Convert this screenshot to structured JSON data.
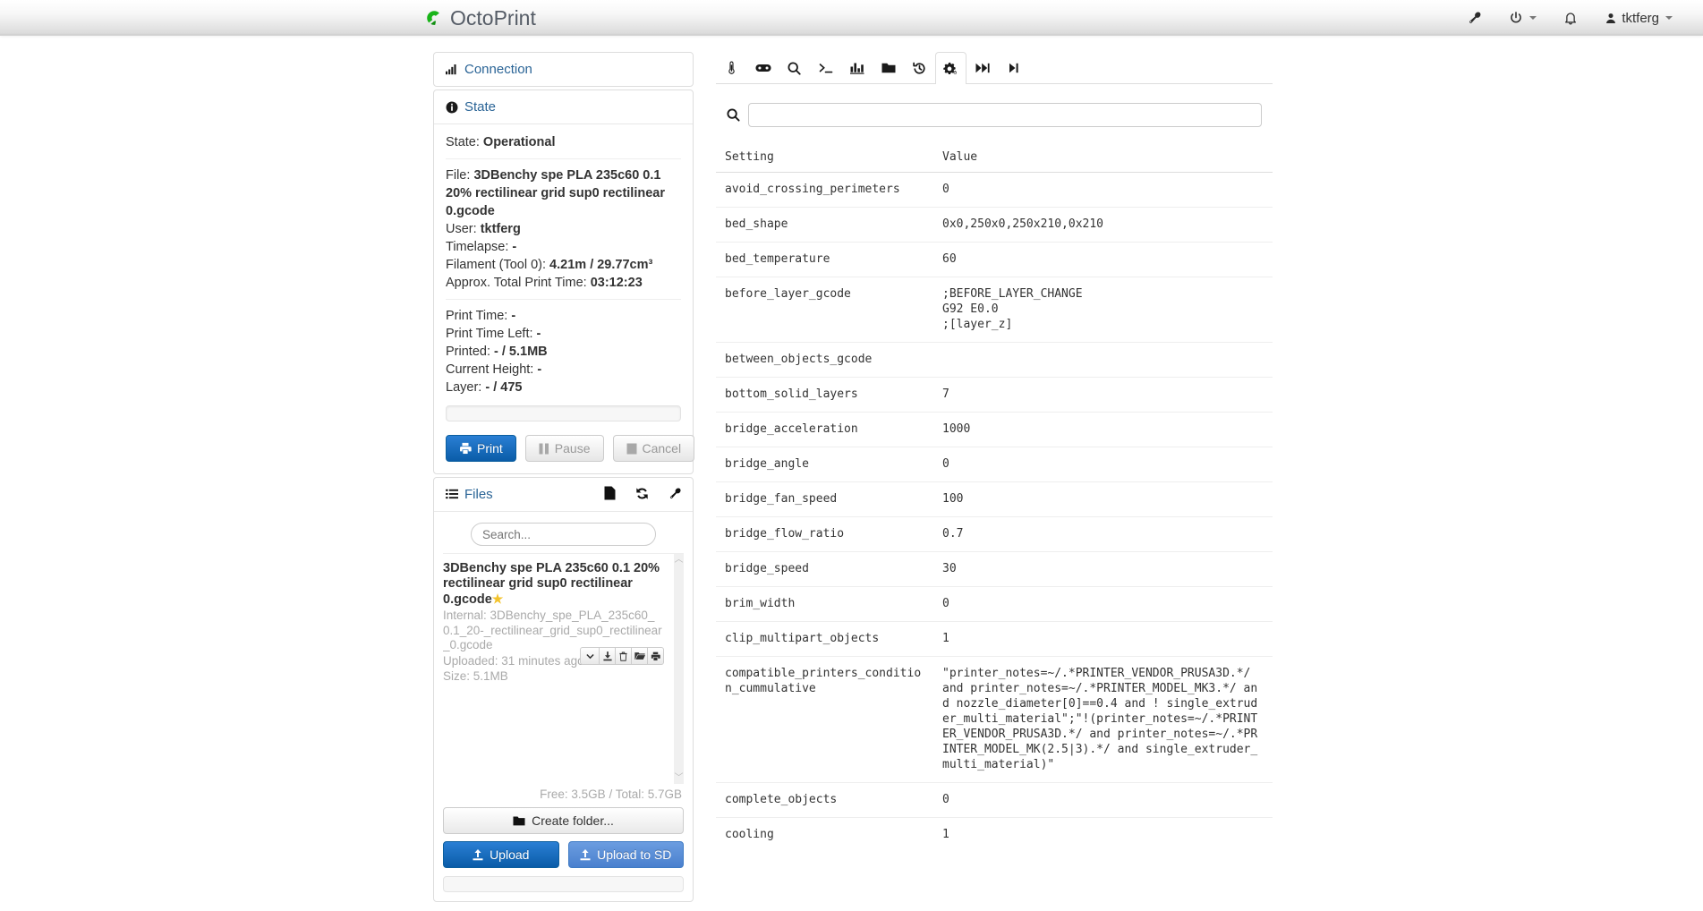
{
  "navbar": {
    "brand": "OctoPrint",
    "items": [
      {
        "name": "wrench-icon",
        "label": "",
        "icon": "wrench"
      },
      {
        "name": "power-icon",
        "label": "",
        "icon": "power",
        "caret": true
      },
      {
        "name": "bell-icon",
        "label": "",
        "icon": "bell"
      },
      {
        "name": "user-menu",
        "label": "tktferg",
        "icon": "user",
        "caret": true
      }
    ],
    "user": "tktferg"
  },
  "sidebar": {
    "connection": {
      "title": "Connection",
      "icon": "signal-icon"
    },
    "state": {
      "title": "State",
      "icon": "info-icon",
      "rows_top": [
        {
          "label": "State:",
          "value": "Operational"
        }
      ],
      "rows_mid": [
        {
          "label": "File:",
          "value": "3DBenchy spe PLA 235c60 0.1 20% rectilinear grid sup0 rectilinear 0.gcode"
        },
        {
          "label": "User:",
          "value": "tktferg"
        },
        {
          "label": "Timelapse:",
          "value": "-"
        },
        {
          "label": "Filament (Tool 0):",
          "value": "4.21m / 29.77cm³"
        },
        {
          "label": "Approx. Total Print Time:",
          "value": "03:12:23"
        }
      ],
      "rows_bottom": [
        {
          "label": "Print Time:",
          "value": "-"
        },
        {
          "label": "Print Time Left:",
          "value": "-"
        },
        {
          "label": "Printed:",
          "value": "- / 5.1MB"
        },
        {
          "label": "Current Height:",
          "value": "-"
        },
        {
          "label": "Layer:",
          "value": "- / 475"
        }
      ],
      "buttons": [
        {
          "name": "print-button",
          "label": "Print",
          "icon": "print",
          "style": "primary"
        },
        {
          "name": "pause-button",
          "label": "Pause",
          "icon": "pause",
          "style": "disabled"
        },
        {
          "name": "cancel-button",
          "label": "Cancel",
          "icon": "stop",
          "style": "disabled"
        }
      ]
    },
    "files": {
      "title": "Files",
      "icon": "list-icon",
      "head_icons": [
        "file-icon",
        "refresh-icon",
        "wrench-icon"
      ],
      "search_placeholder": "Search...",
      "entry": {
        "title": "3DBenchy spe PLA 235c60 0.1 20% rectilinear grid sup0 rectilinear 0.gcode",
        "star": "★",
        "internal": "Internal: 3DBenchy_spe_PLA_235c60_0.1_20-_rectilinear_grid_sup0_rectilinear_0.gcode",
        "uploaded": "Uploaded: 31 minutes ago",
        "size": "Size: 5.1MB",
        "actions": [
          "chevron-down-icon",
          "download-icon",
          "trash-icon",
          "folder-move-icon",
          "print-icon"
        ]
      },
      "free_space": "Free: 3.5GB / Total: 5.7GB",
      "create_folder_label": "Create folder...",
      "upload_label": "Upload",
      "upload_sd_label": "Upload to SD"
    }
  },
  "main": {
    "tabs": [
      {
        "name": "tab-temperature",
        "icon": "thermometer",
        "active": false
      },
      {
        "name": "tab-control",
        "icon": "gamepad",
        "active": false
      },
      {
        "name": "tab-gcode-viewer",
        "icon": "search",
        "active": false
      },
      {
        "name": "tab-terminal",
        "icon": "terminal",
        "active": false
      },
      {
        "name": "tab-statistics",
        "icon": "chart",
        "active": false
      },
      {
        "name": "tab-files",
        "icon": "folder",
        "active": false
      },
      {
        "name": "tab-history",
        "icon": "history",
        "active": false
      },
      {
        "name": "tab-slicer-settings",
        "icon": "gears",
        "active": true
      },
      {
        "name": "tab-forward",
        "icon": "forward",
        "active": false
      },
      {
        "name": "tab-step-forward",
        "icon": "step-forward",
        "active": false
      }
    ],
    "search": {
      "value": "",
      "placeholder": "",
      "icon": "search-icon"
    },
    "table": {
      "columns": [
        "Setting",
        "Value"
      ],
      "rows": [
        {
          "setting": "avoid_crossing_perimeters",
          "value": "0"
        },
        {
          "setting": "bed_shape",
          "value": "0x0,250x0,250x210,0x210"
        },
        {
          "setting": "bed_temperature",
          "value": "60"
        },
        {
          "setting": "before_layer_gcode",
          "value": ";BEFORE_LAYER_CHANGE\nG92 E0.0\n;[layer_z]"
        },
        {
          "setting": "between_objects_gcode",
          "value": ""
        },
        {
          "setting": "bottom_solid_layers",
          "value": "7"
        },
        {
          "setting": "bridge_acceleration",
          "value": "1000"
        },
        {
          "setting": "bridge_angle",
          "value": "0"
        },
        {
          "setting": "bridge_fan_speed",
          "value": "100"
        },
        {
          "setting": "bridge_flow_ratio",
          "value": "0.7"
        },
        {
          "setting": "bridge_speed",
          "value": "30"
        },
        {
          "setting": "brim_width",
          "value": "0"
        },
        {
          "setting": "clip_multipart_objects",
          "value": "1"
        },
        {
          "setting": "compatible_printers_condition_cummulative",
          "value": "\"printer_notes=~/.*PRINTER_VENDOR_PRUSA3D.*/ and printer_notes=~/.*PRINTER_MODEL_MK3.*/ and nozzle_diameter[0]==0.4 and ! single_extruder_multi_material\";\"!(printer_notes=~/.*PRINTER_VENDOR_PRUSA3D.*/ and printer_notes=~/.*PRINTER_MODEL_MK(2.5|3).*/ and single_extruder_multi_material)\""
        },
        {
          "setting": "complete_objects",
          "value": "0"
        },
        {
          "setting": "cooling",
          "value": "1"
        }
      ]
    }
  },
  "colors": {
    "link": "#2a6496",
    "primary": "#0a5ca8",
    "info": "#4a80ce",
    "star": "#f3c32c",
    "logo_green": "#19b419"
  }
}
